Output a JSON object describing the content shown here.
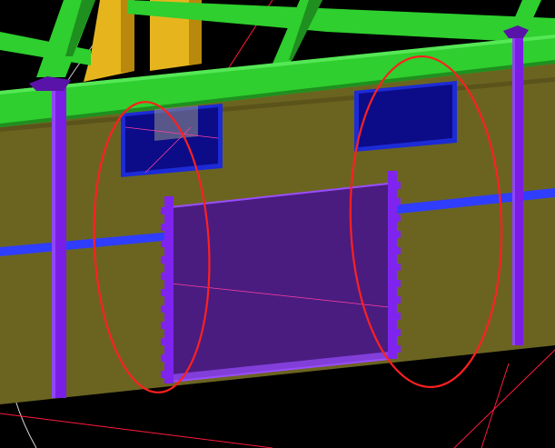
{
  "viewport": {
    "background": "#000000",
    "text": []
  },
  "palette": {
    "wall": "#6b6421",
    "wall_edge": "#4f4a17",
    "beam": "#2ecf2e",
    "beam_shadow": "#1f8f1f",
    "column": "#7a1ee6",
    "column_top": "#5a13a8",
    "stud": "#7f24ee",
    "pipe": "#2f3dff",
    "window_frame": "#1c2bd6",
    "window_glass": "#0c0c88",
    "door_fill": "#4a1c80",
    "door_edge": "#9a4dff",
    "post": "#e6b51e",
    "annotation": "#ff2020",
    "guide_line": "#ff1a3c",
    "guide_white": "#d8d8d8"
  },
  "annotations": [
    {
      "name": "left-jamb-highlight",
      "shape": "ellipse",
      "color": "#ff2020"
    },
    {
      "name": "right-jamb-highlight",
      "shape": "ellipse",
      "color": "#ff2020"
    }
  ],
  "objects": [
    "roof-beam",
    "rafter",
    "vertical-post",
    "wall-panel",
    "wall-column",
    "window",
    "door-opening",
    "door-jamb-stud",
    "pipe"
  ]
}
